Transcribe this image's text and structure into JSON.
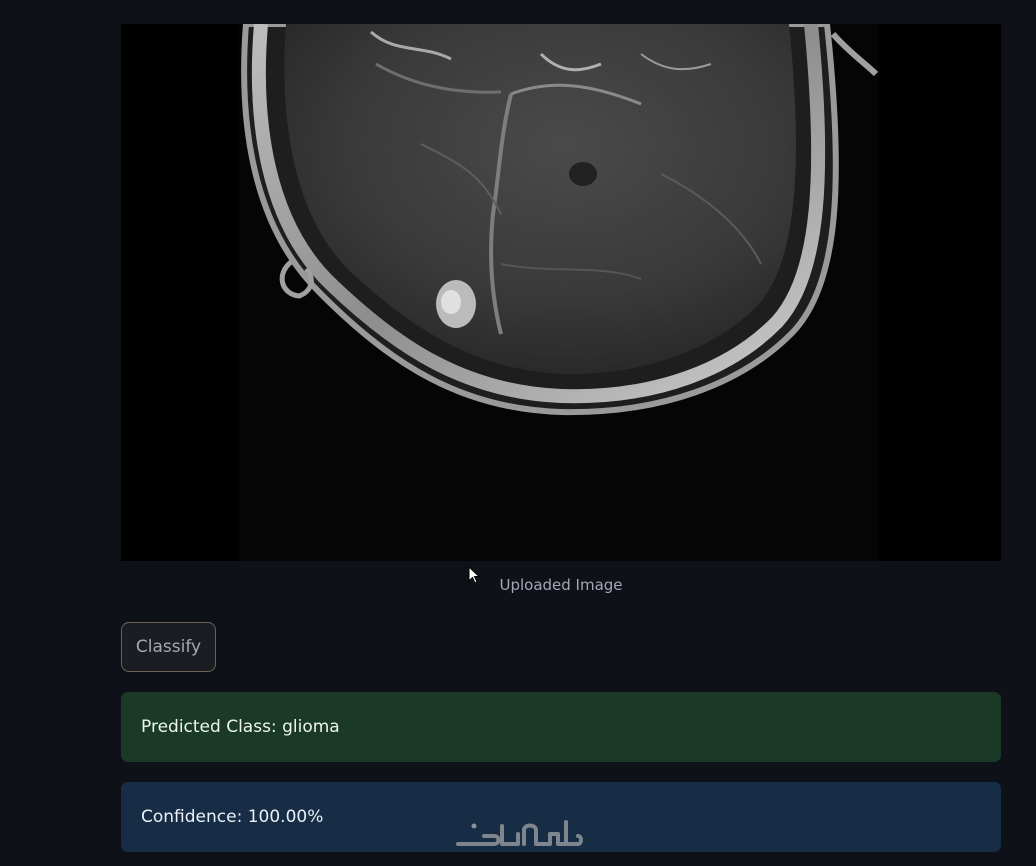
{
  "uploaded_image": {
    "caption": "Uploaded Image"
  },
  "actions": {
    "classify_label": "Classify"
  },
  "results": {
    "predicted_class_label": "Predicted Class:",
    "predicted_class_value": "glioma",
    "confidence_label": "Confidence:",
    "confidence_value": "100.00%"
  },
  "watermark": {
    "text": "خمسات"
  },
  "colors": {
    "page_background": "#0e1117",
    "success_background": "#1a3a27",
    "info_background": "#172d45",
    "button_border": "#6b6353"
  }
}
